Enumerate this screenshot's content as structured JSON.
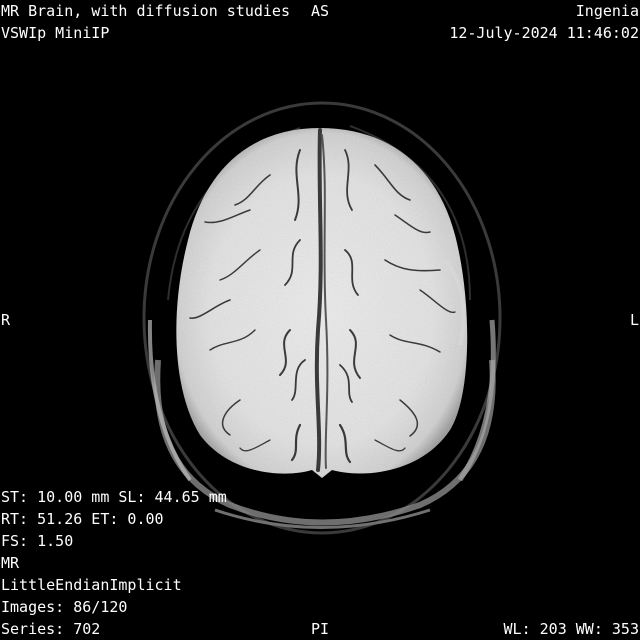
{
  "overlay": {
    "top_left": {
      "study_description": "MR Brain, with diffusion studies",
      "series_description": "VSWIp MiniIP"
    },
    "top_right": {
      "station_name": "Ingenia",
      "study_datetime": "12-July-2024 11:46:02"
    },
    "bottom_left": {
      "thickness_location": "ST: 10.00 mm SL: 44.65 mm",
      "timing": "RT: 51.26 ET: 0.00",
      "field_strength": "FS: 1.50",
      "modality": "MR",
      "transfer_syntax": "LittleEndianImplicit",
      "images": "Images: 86/120",
      "series": "Series: 702"
    },
    "bottom_right": {
      "window": "WL: 203 WW: 353"
    },
    "orientation": {
      "top": "AS",
      "bottom": "PI",
      "left": "R",
      "right": "L"
    }
  },
  "colors": {
    "background": "#000000",
    "overlay_text": "#ffffff",
    "brain_tissue": "#e6e6e6",
    "vessels": "#3a3a3a"
  },
  "icons": {
    "image": "axial-brain-mri-minip"
  }
}
